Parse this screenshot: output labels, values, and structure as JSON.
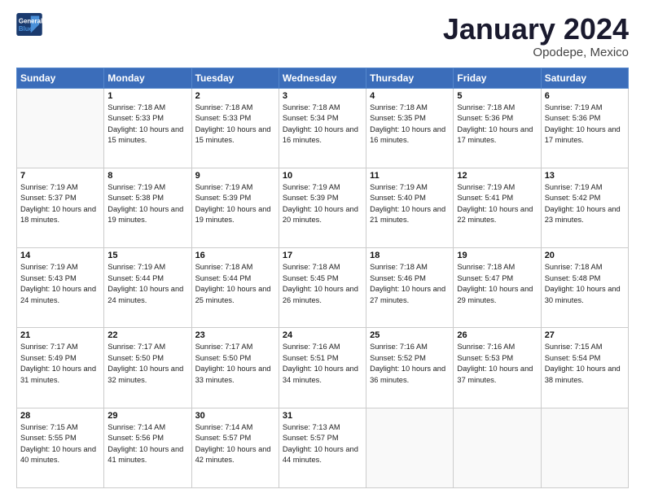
{
  "header": {
    "logo": {
      "line1": "General",
      "line2": "Blue"
    },
    "title": "January 2024",
    "location": "Opodepe, Mexico"
  },
  "weekdays": [
    "Sunday",
    "Monday",
    "Tuesday",
    "Wednesday",
    "Thursday",
    "Friday",
    "Saturday"
  ],
  "weeks": [
    [
      {
        "day": "",
        "sunrise": "",
        "sunset": "",
        "daylight": ""
      },
      {
        "day": "1",
        "sunrise": "Sunrise: 7:18 AM",
        "sunset": "Sunset: 5:33 PM",
        "daylight": "Daylight: 10 hours and 15 minutes."
      },
      {
        "day": "2",
        "sunrise": "Sunrise: 7:18 AM",
        "sunset": "Sunset: 5:33 PM",
        "daylight": "Daylight: 10 hours and 15 minutes."
      },
      {
        "day": "3",
        "sunrise": "Sunrise: 7:18 AM",
        "sunset": "Sunset: 5:34 PM",
        "daylight": "Daylight: 10 hours and 16 minutes."
      },
      {
        "day": "4",
        "sunrise": "Sunrise: 7:18 AM",
        "sunset": "Sunset: 5:35 PM",
        "daylight": "Daylight: 10 hours and 16 minutes."
      },
      {
        "day": "5",
        "sunrise": "Sunrise: 7:18 AM",
        "sunset": "Sunset: 5:36 PM",
        "daylight": "Daylight: 10 hours and 17 minutes."
      },
      {
        "day": "6",
        "sunrise": "Sunrise: 7:19 AM",
        "sunset": "Sunset: 5:36 PM",
        "daylight": "Daylight: 10 hours and 17 minutes."
      }
    ],
    [
      {
        "day": "7",
        "sunrise": "Sunrise: 7:19 AM",
        "sunset": "Sunset: 5:37 PM",
        "daylight": "Daylight: 10 hours and 18 minutes."
      },
      {
        "day": "8",
        "sunrise": "Sunrise: 7:19 AM",
        "sunset": "Sunset: 5:38 PM",
        "daylight": "Daylight: 10 hours and 19 minutes."
      },
      {
        "day": "9",
        "sunrise": "Sunrise: 7:19 AM",
        "sunset": "Sunset: 5:39 PM",
        "daylight": "Daylight: 10 hours and 19 minutes."
      },
      {
        "day": "10",
        "sunrise": "Sunrise: 7:19 AM",
        "sunset": "Sunset: 5:39 PM",
        "daylight": "Daylight: 10 hours and 20 minutes."
      },
      {
        "day": "11",
        "sunrise": "Sunrise: 7:19 AM",
        "sunset": "Sunset: 5:40 PM",
        "daylight": "Daylight: 10 hours and 21 minutes."
      },
      {
        "day": "12",
        "sunrise": "Sunrise: 7:19 AM",
        "sunset": "Sunset: 5:41 PM",
        "daylight": "Daylight: 10 hours and 22 minutes."
      },
      {
        "day": "13",
        "sunrise": "Sunrise: 7:19 AM",
        "sunset": "Sunset: 5:42 PM",
        "daylight": "Daylight: 10 hours and 23 minutes."
      }
    ],
    [
      {
        "day": "14",
        "sunrise": "Sunrise: 7:19 AM",
        "sunset": "Sunset: 5:43 PM",
        "daylight": "Daylight: 10 hours and 24 minutes."
      },
      {
        "day": "15",
        "sunrise": "Sunrise: 7:19 AM",
        "sunset": "Sunset: 5:44 PM",
        "daylight": "Daylight: 10 hours and 24 minutes."
      },
      {
        "day": "16",
        "sunrise": "Sunrise: 7:18 AM",
        "sunset": "Sunset: 5:44 PM",
        "daylight": "Daylight: 10 hours and 25 minutes."
      },
      {
        "day": "17",
        "sunrise": "Sunrise: 7:18 AM",
        "sunset": "Sunset: 5:45 PM",
        "daylight": "Daylight: 10 hours and 26 minutes."
      },
      {
        "day": "18",
        "sunrise": "Sunrise: 7:18 AM",
        "sunset": "Sunset: 5:46 PM",
        "daylight": "Daylight: 10 hours and 27 minutes."
      },
      {
        "day": "19",
        "sunrise": "Sunrise: 7:18 AM",
        "sunset": "Sunset: 5:47 PM",
        "daylight": "Daylight: 10 hours and 29 minutes."
      },
      {
        "day": "20",
        "sunrise": "Sunrise: 7:18 AM",
        "sunset": "Sunset: 5:48 PM",
        "daylight": "Daylight: 10 hours and 30 minutes."
      }
    ],
    [
      {
        "day": "21",
        "sunrise": "Sunrise: 7:17 AM",
        "sunset": "Sunset: 5:49 PM",
        "daylight": "Daylight: 10 hours and 31 minutes."
      },
      {
        "day": "22",
        "sunrise": "Sunrise: 7:17 AM",
        "sunset": "Sunset: 5:50 PM",
        "daylight": "Daylight: 10 hours and 32 minutes."
      },
      {
        "day": "23",
        "sunrise": "Sunrise: 7:17 AM",
        "sunset": "Sunset: 5:50 PM",
        "daylight": "Daylight: 10 hours and 33 minutes."
      },
      {
        "day": "24",
        "sunrise": "Sunrise: 7:16 AM",
        "sunset": "Sunset: 5:51 PM",
        "daylight": "Daylight: 10 hours and 34 minutes."
      },
      {
        "day": "25",
        "sunrise": "Sunrise: 7:16 AM",
        "sunset": "Sunset: 5:52 PM",
        "daylight": "Daylight: 10 hours and 36 minutes."
      },
      {
        "day": "26",
        "sunrise": "Sunrise: 7:16 AM",
        "sunset": "Sunset: 5:53 PM",
        "daylight": "Daylight: 10 hours and 37 minutes."
      },
      {
        "day": "27",
        "sunrise": "Sunrise: 7:15 AM",
        "sunset": "Sunset: 5:54 PM",
        "daylight": "Daylight: 10 hours and 38 minutes."
      }
    ],
    [
      {
        "day": "28",
        "sunrise": "Sunrise: 7:15 AM",
        "sunset": "Sunset: 5:55 PM",
        "daylight": "Daylight: 10 hours and 40 minutes."
      },
      {
        "day": "29",
        "sunrise": "Sunrise: 7:14 AM",
        "sunset": "Sunset: 5:56 PM",
        "daylight": "Daylight: 10 hours and 41 minutes."
      },
      {
        "day": "30",
        "sunrise": "Sunrise: 7:14 AM",
        "sunset": "Sunset: 5:57 PM",
        "daylight": "Daylight: 10 hours and 42 minutes."
      },
      {
        "day": "31",
        "sunrise": "Sunrise: 7:13 AM",
        "sunset": "Sunset: 5:57 PM",
        "daylight": "Daylight: 10 hours and 44 minutes."
      },
      {
        "day": "",
        "sunrise": "",
        "sunset": "",
        "daylight": ""
      },
      {
        "day": "",
        "sunrise": "",
        "sunset": "",
        "daylight": ""
      },
      {
        "day": "",
        "sunrise": "",
        "sunset": "",
        "daylight": ""
      }
    ]
  ]
}
